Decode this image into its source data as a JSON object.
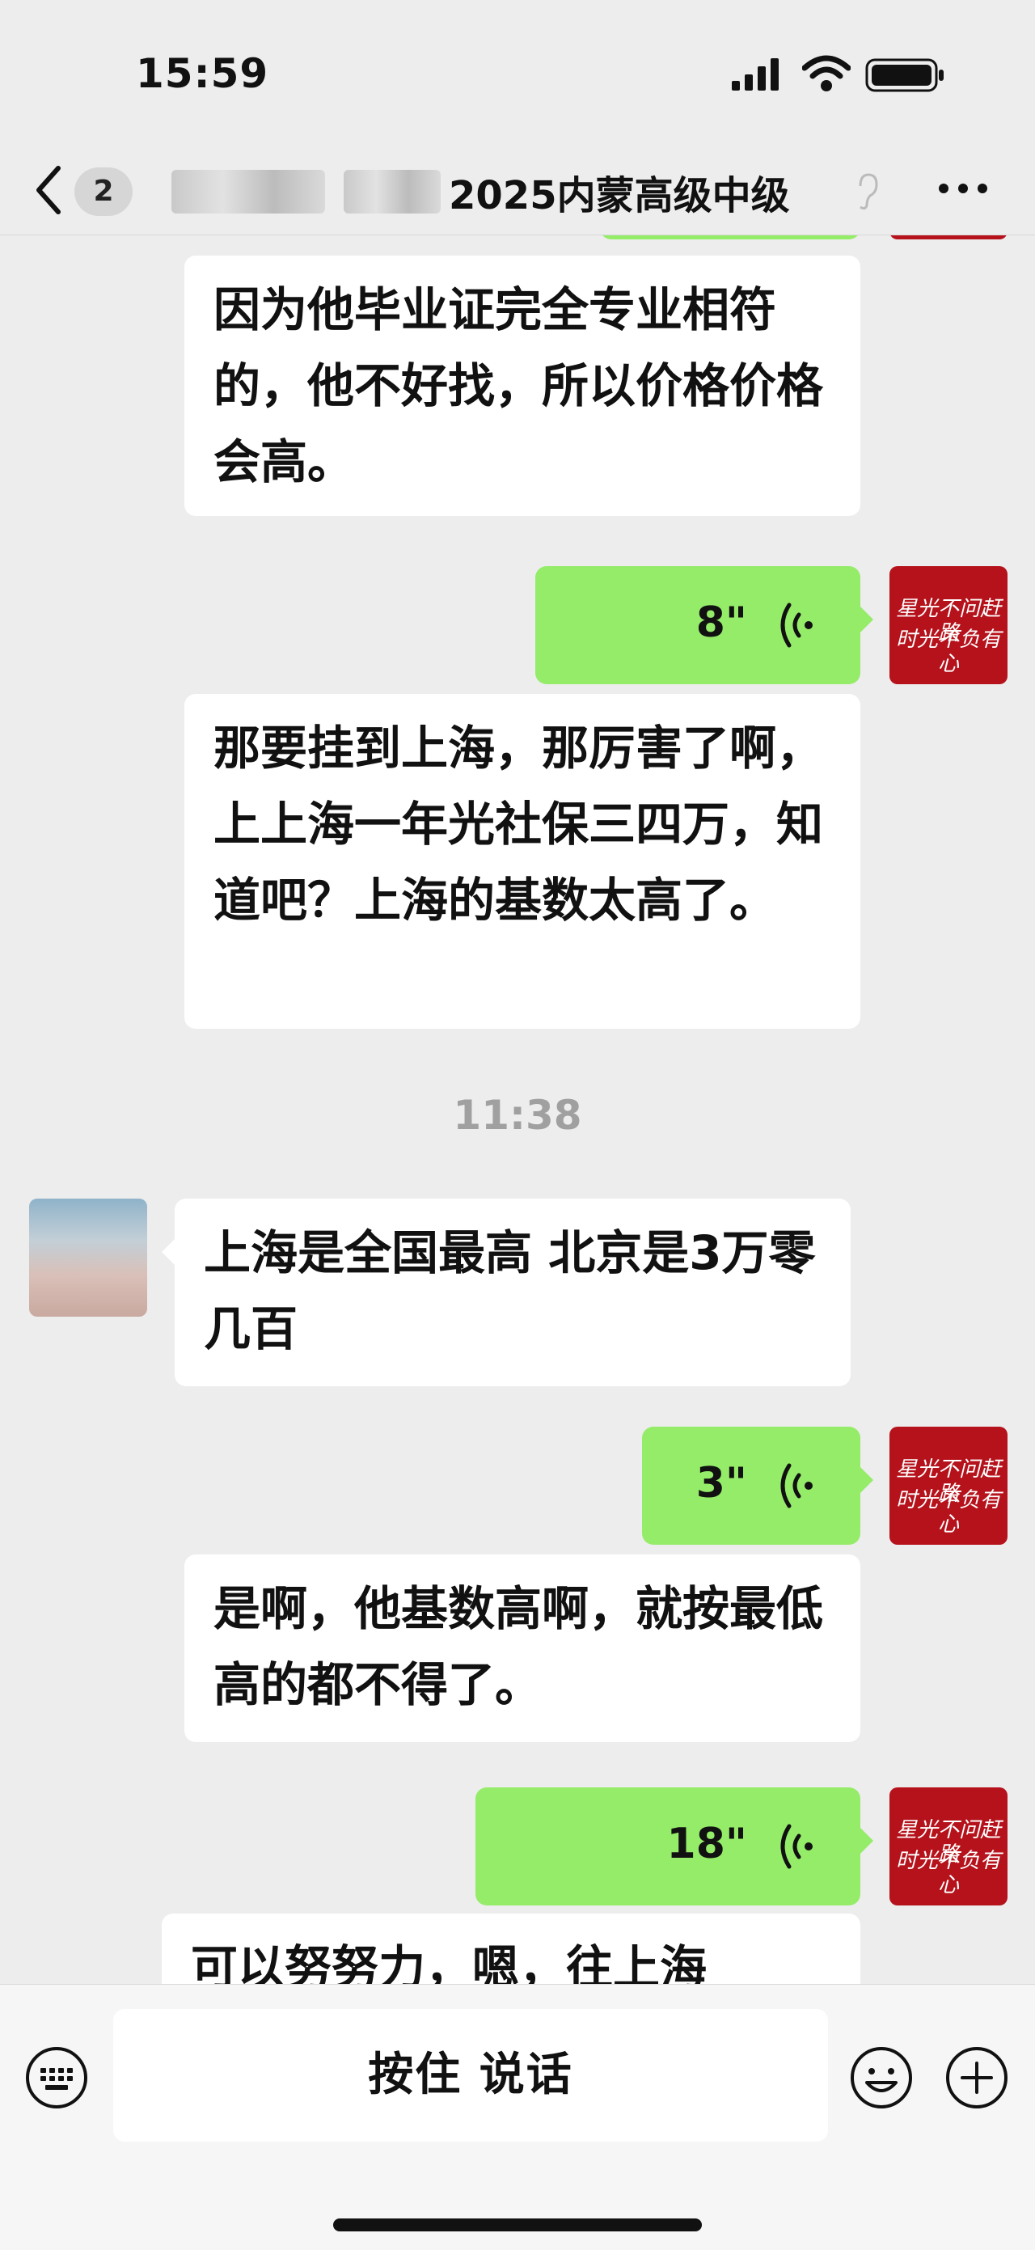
{
  "status_bar": {
    "time": "15:59"
  },
  "header": {
    "unread_count": "2",
    "title": "2025内蒙高级中级"
  },
  "messages": [
    {
      "type": "text",
      "side": "left",
      "text": "因为他毕业证完全专业相符的，他不好找，所以价格价格会高。"
    },
    {
      "type": "voice",
      "side": "right",
      "duration": "8\""
    },
    {
      "type": "text",
      "side": "left",
      "text": "那要挂到上海，那厉害了啊，上上海一年光社保三四万，知道吧？上海的基数太高了。"
    },
    {
      "type": "timestamp",
      "text": "11:38"
    },
    {
      "type": "text",
      "side": "left",
      "text": "上海是全国最高 北京是3万零几百"
    },
    {
      "type": "voice",
      "side": "right",
      "duration": "3\""
    },
    {
      "type": "text",
      "side": "left",
      "text": "是啊，他基数高啊，就按最低高的都不得了。"
    },
    {
      "type": "voice",
      "side": "right",
      "duration": "18\""
    },
    {
      "type": "text",
      "side": "left",
      "text": "可以努努力，嗯，往上海"
    }
  ],
  "avatar_me_text": [
    "星光不问赶路",
    "时光不负有心"
  ],
  "input_bar": {
    "hold_to_talk": "按住 说话"
  },
  "colors": {
    "self_bubble": "#95ec69",
    "other_bubble": "#ffffff",
    "background": "#ededed",
    "avatar_me": "#b5121b"
  }
}
